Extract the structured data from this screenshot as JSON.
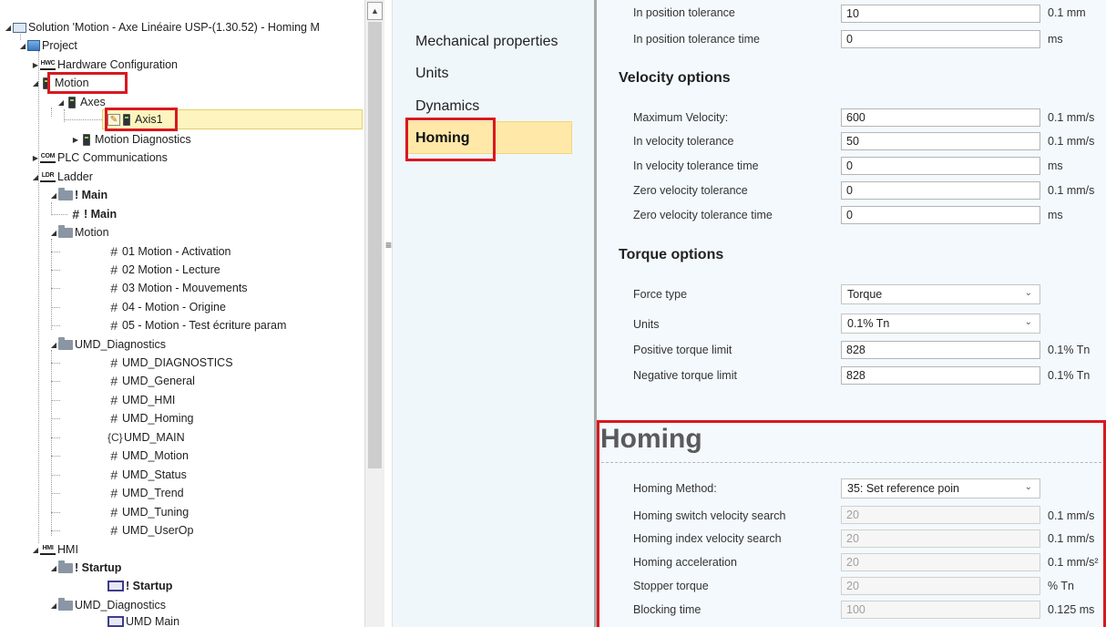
{
  "tree": {
    "solution": "Solution 'Motion - Axe Linéaire USP-(1.30.52) - Homing M",
    "project": "Project",
    "hardware_icon": "HWC",
    "hardware": "Hardware Configuration",
    "motion": "Motion",
    "axes": "Axes",
    "axis1": "Axis1",
    "motion_diag": "Motion Diagnostics",
    "plc_icon": "COM",
    "plc": "PLC Communications",
    "ladder_icon": "LDR",
    "ladder": "Ladder",
    "main_folder": "! Main",
    "main_prog": "! Main",
    "motion_folder": "Motion",
    "motion_progs": [
      "01 Motion - Activation",
      "02 Motion - Lecture",
      "03 Motion - Mouvements",
      "04 - Motion - Origine",
      "05 - Motion - Test écriture param"
    ],
    "umd_folder": "UMD_Diagnostics",
    "umd_progs": [
      "UMD_DIAGNOSTICS",
      "UMD_General",
      "UMD_HMI",
      "UMD_Homing",
      "UMD_MAIN",
      "UMD_Motion",
      "UMD_Status",
      "UMD_Trend",
      "UMD_Tuning",
      "UMD_UserOp"
    ],
    "hmi_icon": "HMI",
    "hmi": "HMI",
    "startup_folder": "! Startup",
    "startup_screen": "! Startup",
    "hmi_umd_folder": "UMD_Diagnostics",
    "umd_main_screen": "UMD Main"
  },
  "nav": {
    "items": [
      "Mechanical properties",
      "Units",
      "Dynamics"
    ],
    "active": "Homing"
  },
  "position": {
    "tolerance_label": "In position tolerance",
    "tolerance_value": "10",
    "tolerance_unit": "0.1 mm",
    "time_label": "In position tolerance time",
    "time_value": "0",
    "time_unit": "ms"
  },
  "velocity": {
    "title": "Velocity options",
    "rows": [
      {
        "label": "Maximum Velocity:",
        "value": "600",
        "unit": "0.1 mm/s"
      },
      {
        "label": "In velocity tolerance",
        "value": "50",
        "unit": "0.1 mm/s"
      },
      {
        "label": "In velocity tolerance time",
        "value": "0",
        "unit": "ms"
      },
      {
        "label": "Zero velocity tolerance",
        "value": "0",
        "unit": "0.1 mm/s"
      },
      {
        "label": "Zero velocity tolerance time",
        "value": "0",
        "unit": "ms"
      }
    ]
  },
  "torque": {
    "title": "Torque options",
    "force_label": "Force type",
    "force_value": "Torque",
    "units_label": "Units",
    "units_value": "0.1% Tn",
    "pos_label": "Positive torque limit",
    "pos_value": "828",
    "pos_unit": "0.1% Tn",
    "neg_label": "Negative torque limit",
    "neg_value": "828",
    "neg_unit": "0.1% Tn"
  },
  "homing": {
    "title": "Homing",
    "method_label": "Homing Method:",
    "method_value": "35: Set reference poin",
    "rows": [
      {
        "label": "Homing switch velocity search",
        "value": "20",
        "unit": "0.1 mm/s"
      },
      {
        "label": "Homing index velocity search",
        "value": "20",
        "unit": "0.1 mm/s"
      },
      {
        "label": "Homing acceleration",
        "value": "20",
        "unit": "0.1 mm/s²"
      },
      {
        "label": "Stopper torque",
        "value": "20",
        "unit": "% Tn"
      },
      {
        "label": "Blocking time",
        "value": "100",
        "unit": "0.125 ms"
      }
    ]
  },
  "colors": {
    "highlight_red": "#d9181f",
    "selection_yellow": "#fdf4bf",
    "nav_active": "#ffe8a8"
  }
}
